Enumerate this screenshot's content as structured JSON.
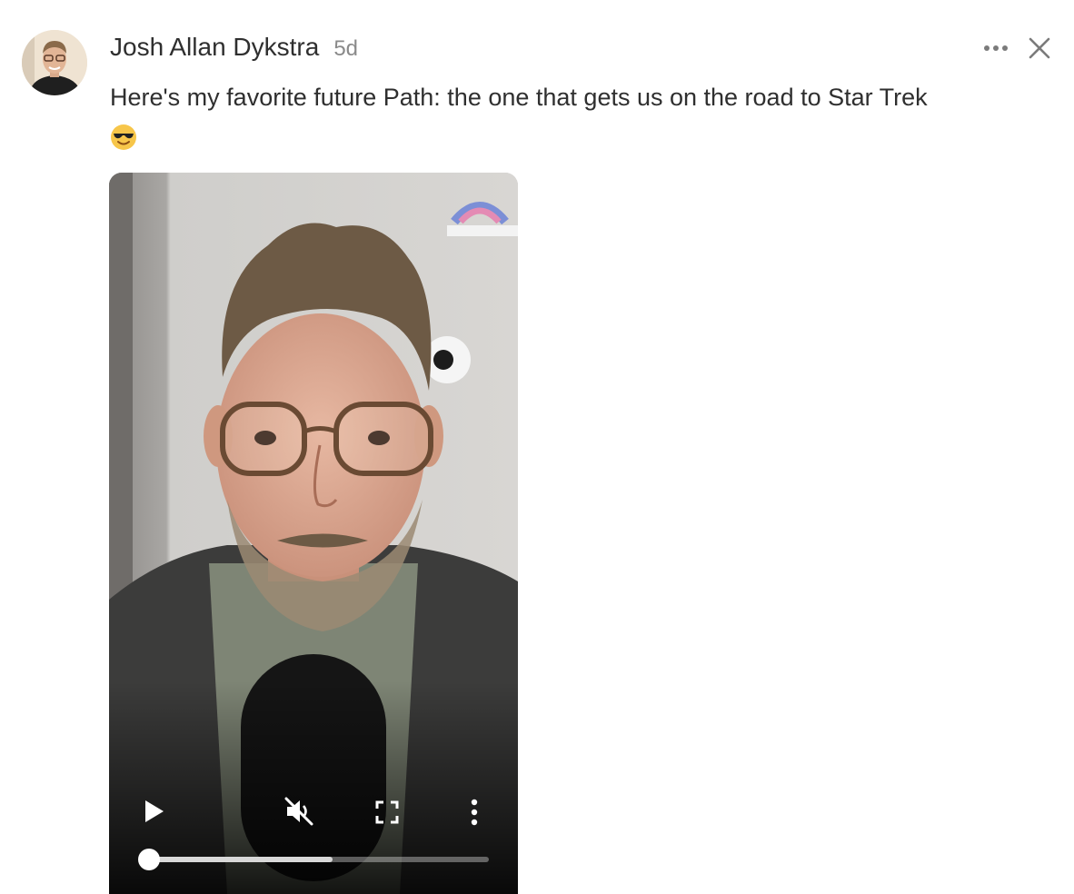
{
  "post": {
    "author": "Josh Allan Dykstra",
    "time": "5d",
    "text": "Here's my favorite future Path: the one that gets us on the road to Star Trek",
    "emoji": "smiling-face-with-sunglasses"
  },
  "video": {
    "controls": {
      "play_icon": "play-icon",
      "mute_icon": "muted-speaker-icon",
      "fullscreen_icon": "fullscreen-icon",
      "menu_icon": "vertical-dots-icon"
    },
    "progress_buffered_fraction": 0.54,
    "progress_played_fraction": 0.0
  },
  "icons": {
    "more": "more-horizontal-icon",
    "close": "close-icon"
  }
}
